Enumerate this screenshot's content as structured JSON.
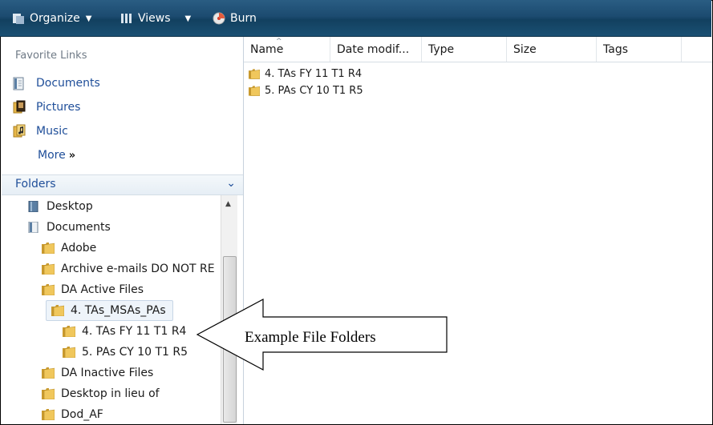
{
  "toolbar": {
    "organize": "Organize",
    "views": "Views",
    "burn": "Burn"
  },
  "favorites": {
    "title": "Favorite Links",
    "items": [
      {
        "label": "Documents",
        "icon": "documents-icon"
      },
      {
        "label": "Pictures",
        "icon": "pictures-icon"
      },
      {
        "label": "Music",
        "icon": "music-icon"
      }
    ],
    "more": "More",
    "more_chevron": "»"
  },
  "folders": {
    "title": "Folders",
    "tree": [
      {
        "label": "Desktop"
      },
      {
        "label": "Documents"
      },
      {
        "label": "Adobe"
      },
      {
        "label": "Archive e-mails DO NOT RE"
      },
      {
        "label": "DA Active Files"
      },
      {
        "label": "4. TAs_MSAs_PAs"
      },
      {
        "label": "4. TAs FY 11 T1 R4"
      },
      {
        "label": "5. PAs CY 10 T1 R5"
      },
      {
        "label": "DA Inactive Files"
      },
      {
        "label": "Desktop in lieu of"
      },
      {
        "label": "Dod_AF"
      }
    ]
  },
  "columns": [
    "Name",
    "Date modif...",
    "Type",
    "Size",
    "Tags"
  ],
  "files": [
    {
      "name": "4. TAs FY 11 T1 R4"
    },
    {
      "name": "5. PAs CY 10 T1 R5"
    }
  ],
  "callout": "Example File Folders",
  "colors": {
    "toolbar": "#1c4b70",
    "link": "#1f4e99",
    "folder": "#e8b84a"
  }
}
